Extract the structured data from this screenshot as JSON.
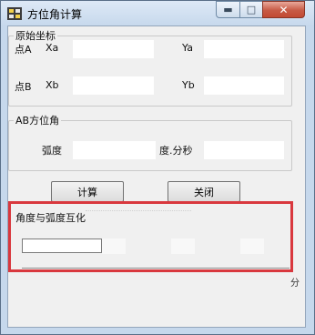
{
  "window": {
    "title": "方位角计算",
    "min_glyph": "▬",
    "max_glyph": "□",
    "close_glyph": "✕"
  },
  "group_original": {
    "legend": "原始坐标",
    "point_a": "点A",
    "xa": "Xa",
    "ya": "Ya",
    "point_b": "点B",
    "xb": "Xb",
    "yb": "Yb",
    "values": {
      "xa": "",
      "ya": "",
      "xb": "",
      "yb": ""
    }
  },
  "group_azimuth": {
    "legend": "AB方位角",
    "radian_label": "弧度",
    "dms_label": "度.分秒",
    "values": {
      "radian": "",
      "dms": ""
    }
  },
  "buttons": {
    "calculate": "计算",
    "close": "关闭"
  },
  "group_convert": {
    "legend": "角度与弧度互化",
    "input_value": "",
    "overflow_char": "分"
  },
  "colors": {
    "highlight": "#d9383e",
    "frame": "#c6d8ec",
    "close_button": "#c75a45"
  },
  "icons": {
    "app": "calculator-icon",
    "minimize": "minimize-icon",
    "maximize": "maximize-icon",
    "close": "close-icon"
  }
}
